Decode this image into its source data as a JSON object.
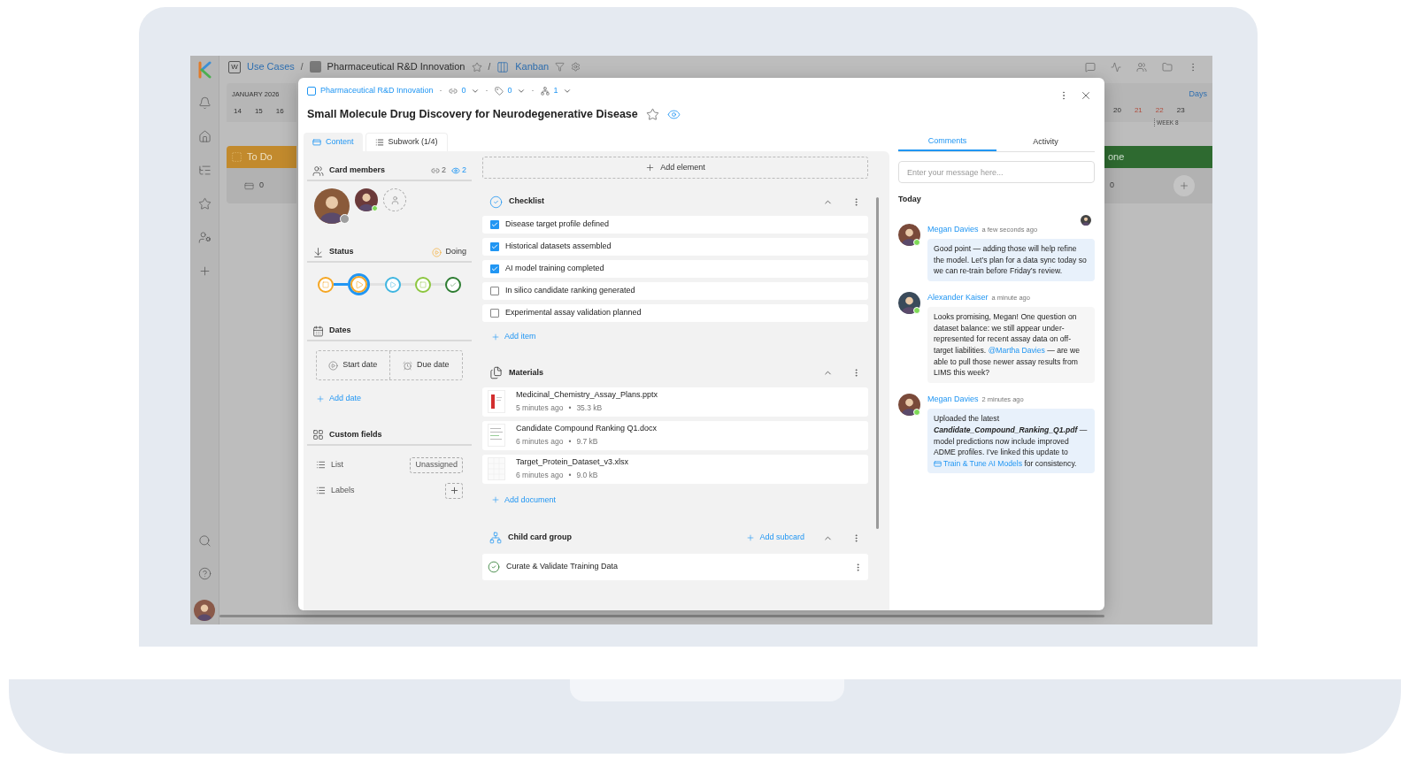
{
  "app": {
    "breadcrumb": {
      "badge": "W",
      "separator": "/",
      "items": [
        {
          "kind": "workspace",
          "label": "Use Cases"
        },
        {
          "kind": "project",
          "label": "Pharmaceutical R&D Innovation"
        },
        {
          "kind": "view",
          "label": "Kanban"
        }
      ]
    },
    "calendar_left": {
      "month": "JANUARY 2026",
      "days": [
        {
          "label": "14",
          "weekend": false
        },
        {
          "label": "15",
          "weekend": false
        },
        {
          "label": "16",
          "weekend": false
        }
      ]
    },
    "calendar_right": {
      "view": {
        "label": "Days",
        "selected": true
      },
      "week": "WEEK 8",
      "days": [
        {
          "label": "20",
          "weekend": false
        },
        {
          "label": "21",
          "weekend": true
        },
        {
          "label": "22",
          "weekend": true
        },
        {
          "label": "23",
          "weekend": false
        }
      ]
    },
    "columns": [
      {
        "title": "To Do",
        "color": "#c28a2d",
        "count": "0"
      },
      {
        "title": "one",
        "color": "#2e6a30",
        "count": "0"
      }
    ]
  },
  "card": {
    "breadcrumb": {
      "project": "Pharmaceutical R&D Innovation",
      "separator": "·",
      "counters": [
        {
          "kind": "link",
          "value": "0"
        },
        {
          "kind": "tag",
          "value": "0"
        },
        {
          "kind": "subcards",
          "value": "1"
        }
      ]
    },
    "title": "Small Molecule Drug Discovery for Neurodegenerative Disease",
    "starred": false,
    "watching": true,
    "tabs": [
      {
        "label": "Content",
        "selected": true
      },
      {
        "label": "Subwork (1/4)",
        "selected": false
      }
    ],
    "members": {
      "title": "Card members",
      "counts": [
        {
          "kind": "link",
          "value": "2"
        },
        {
          "kind": "watchers",
          "value": "2"
        }
      ],
      "people": [
        {
          "kind": "owner",
          "online": false
        },
        {
          "kind": "member",
          "online": true
        }
      ]
    },
    "status": {
      "title": "Status",
      "value": "Doing",
      "steps": [
        {
          "kind": "todo",
          "color": "#f5a623",
          "selected": false
        },
        {
          "kind": "doing",
          "color": "#f5a623",
          "selected": true
        },
        {
          "kind": "review",
          "color": "#3fb5e0",
          "selected": false
        },
        {
          "kind": "paused",
          "color": "#8cc63f",
          "selected": false
        },
        {
          "kind": "done",
          "color": "#2e7d32",
          "selected": false
        }
      ]
    },
    "dates": {
      "title": "Dates",
      "buttons": [
        {
          "kind": "start",
          "label": "Start date"
        },
        {
          "kind": "due",
          "label": "Due date"
        }
      ],
      "add": "Add date"
    },
    "custom_fields": {
      "title": "Custom fields",
      "fields": [
        {
          "kind": "list",
          "label": "List",
          "value": "Unassigned"
        },
        {
          "kind": "labels",
          "label": "Labels"
        }
      ]
    },
    "add_element": "Add element",
    "checklist": {
      "title": "Checklist",
      "add": "Add item",
      "items": [
        {
          "label": "Disease target profile defined",
          "checked": true
        },
        {
          "label": "Historical datasets assembled",
          "checked": true
        },
        {
          "label": "AI model training completed",
          "checked": true
        },
        {
          "label": "In silico candidate ranking generated",
          "checked": false
        },
        {
          "label": "Experimental assay validation planned",
          "checked": false
        }
      ]
    },
    "materials": {
      "title": "Materials",
      "add": "Add document",
      "separator": "•",
      "files": [
        {
          "kind": "pptx",
          "name": "Medicinal_Chemistry_Assay_Plans.pptx",
          "age": "5 minutes ago",
          "size": "35.3 kB"
        },
        {
          "kind": "docx",
          "name": "Candidate Compound Ranking Q1.docx",
          "age": "6 minutes ago",
          "size": "9.7 kB"
        },
        {
          "kind": "xlsx",
          "name": "Target_Protein_Dataset_v3.xlsx",
          "age": "6 minutes ago",
          "size": "9.0 kB"
        }
      ]
    },
    "child_group": {
      "title": "Child card group",
      "add": "Add subcard",
      "cards": [
        {
          "title": "Curate & Validate Training Data",
          "done": true
        }
      ]
    },
    "comments": {
      "tabs": [
        {
          "label": "Comments",
          "selected": true
        },
        {
          "label": "Activity",
          "selected": false
        }
      ],
      "placeholder": "Enter your message here...",
      "day": "Today",
      "items": [
        {
          "author": "Megan Davies",
          "time": "a few seconds ago",
          "online": true,
          "highlighted": true,
          "parts": [
            {
              "kind": "text",
              "text": "Good point — adding those will help refine the model. Let’s plan for a data sync today so we can re-train before Friday’s review."
            }
          ]
        },
        {
          "author": "Alexander Kaiser",
          "time": "a minute ago",
          "online": true,
          "highlighted": false,
          "parts": [
            {
              "kind": "text",
              "text": "Looks promising, Megan! One question on dataset balance: we still appear under-represented for recent assay data on off-target liabilities. "
            },
            {
              "kind": "mention",
              "text": "@Martha Davies"
            },
            {
              "kind": "text",
              "text": " — are we able to pull those newer assay results from LIMS this week?"
            }
          ]
        },
        {
          "author": "Megan Davies",
          "time": "2 minutes ago",
          "online": true,
          "highlighted": true,
          "parts": [
            {
              "kind": "text",
              "text": "Uploaded the latest "
            },
            {
              "kind": "file",
              "text": "Candidate_Compound_Ranking_Q1.pdf"
            },
            {
              "kind": "text",
              "text": " — model predictions now include improved ADME profiles. I’ve linked this update to "
            },
            {
              "kind": "link",
              "text": "Train & Tune AI Models"
            },
            {
              "kind": "text",
              "text": " for consistency."
            }
          ]
        }
      ]
    }
  }
}
